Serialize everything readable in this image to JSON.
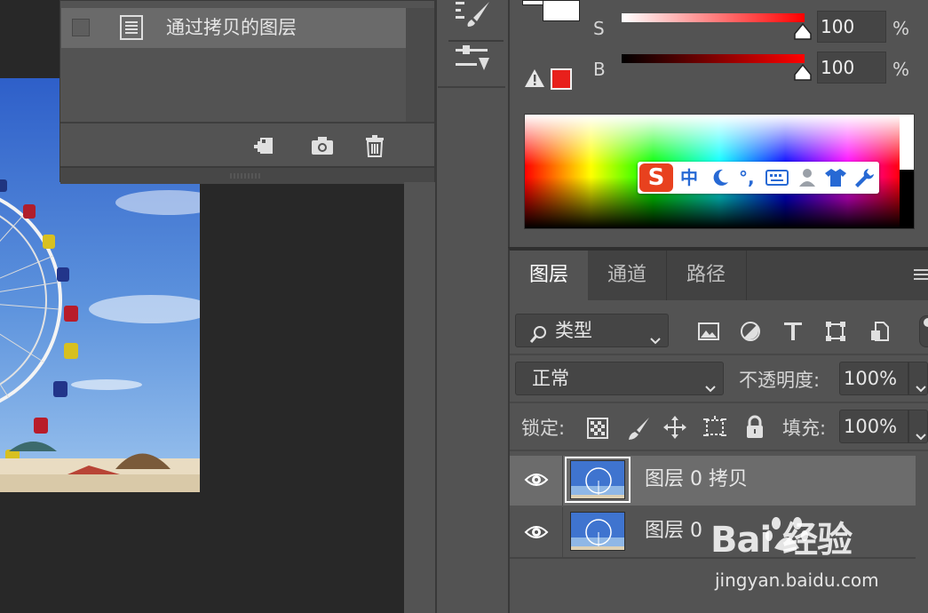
{
  "history": {
    "item_label": "通过拷贝的图层",
    "icons": [
      "new-document-from-state-icon",
      "snapshot-camera-icon",
      "trash-icon"
    ]
  },
  "color": {
    "s_label": "S",
    "b_label": "B",
    "s_value": "100",
    "b_value": "100",
    "percent": "%",
    "accent": "#e8201c"
  },
  "ime": {
    "brand": "S",
    "lang": "中",
    "punct": "°,"
  },
  "layers": {
    "tabs": [
      "图层",
      "通道",
      "路径"
    ],
    "filter_label": "类型",
    "blend_mode": "正常",
    "opacity_label": "不透明度:",
    "opacity_value": "100%",
    "lock_label": "锁定:",
    "fill_label": "填充:",
    "fill_value": "100%",
    "rows": [
      {
        "name": "图层 0 拷贝",
        "selected": true
      },
      {
        "name": "图层 0",
        "selected": false
      }
    ]
  },
  "watermark": {
    "logo": "Bai 经验",
    "url": "jingyan.baidu.com"
  }
}
